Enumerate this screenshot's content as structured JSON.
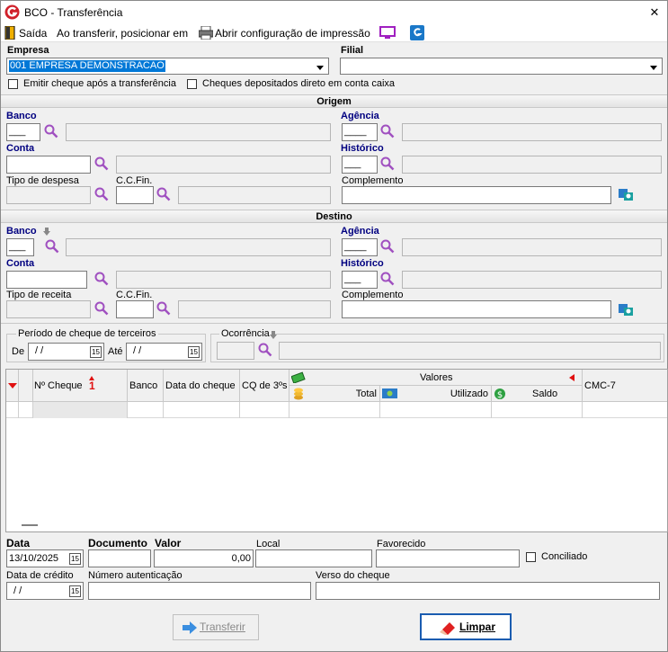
{
  "window": {
    "title": "BCO - Transferência",
    "close_glyph": "✕"
  },
  "toolbar": {
    "exit_label": "Saída",
    "position_label": "Ao transferir, posicionar em",
    "print_config_label": "Abrir configuração de impressão"
  },
  "header": {
    "company_label": "Empresa",
    "company_value": "001 EMPRESA DEMONSTRACAO",
    "branch_label": "Filial",
    "branch_value": "",
    "emit_check_label": "Emitir cheque após a transferência",
    "emit_check_checked": false,
    "deposit_direct_label": "Cheques depositados direto em conta caixa",
    "deposit_direct_checked": false
  },
  "origin": {
    "section_title": "Origem",
    "bank_label": "Banco",
    "bank_value": "___",
    "agency_label": "Agência",
    "agency_value": "____",
    "account_label": "Conta",
    "history_label": "Histórico",
    "history_value": "___",
    "expense_type_label": "Tipo de despesa",
    "ccfin_label": "C.C.Fin.",
    "complement_label": "Complemento"
  },
  "destination": {
    "section_title": "Destino",
    "bank_label": "Banco",
    "bank_value": "___",
    "agency_label": "Agência",
    "agency_value": "____",
    "account_label": "Conta",
    "history_label": "Histórico",
    "history_value": "___",
    "revenue_type_label": "Tipo de receita",
    "ccfin_label": "C.C.Fin.",
    "complement_label": "Complemento"
  },
  "third_party": {
    "group_label": "Período de cheque de terceiros",
    "from_label": "De",
    "from_value": " / /",
    "to_label": "Até",
    "to_value": " / /",
    "occurrence_label": "Ocorrência"
  },
  "grid": {
    "sort_indicator": "1",
    "columns": {
      "check_number": "Nº Cheque",
      "bank": "Banco",
      "check_date": "Data do cheque",
      "third_party": "CQ de 3ºs",
      "values_group": "Valores",
      "total": "Total",
      "used": "Utilizado",
      "balance": "Saldo",
      "cmc7": "CMC-7"
    }
  },
  "footer": {
    "date_label": "Data",
    "date_value": "13/10/2025",
    "document_label": "Documento",
    "document_value": "",
    "value_label": "Valor",
    "value_value": "0,00",
    "place_label": "Local",
    "payee_label": "Favorecido",
    "reconciled_label": "Conciliado",
    "reconciled_checked": false,
    "credit_date_label": "Data de crédito",
    "credit_date_value": " / /",
    "auth_number_label": "Número autenticação",
    "check_back_label": "Verso do cheque"
  },
  "actions": {
    "transfer_label": "Transferir",
    "clear_label": "Limpar"
  },
  "colors": {
    "accent_label": "#000080",
    "app_logo": "#d0202a",
    "icon_magnifier": "#a050c0",
    "selection": "#0078d7"
  }
}
